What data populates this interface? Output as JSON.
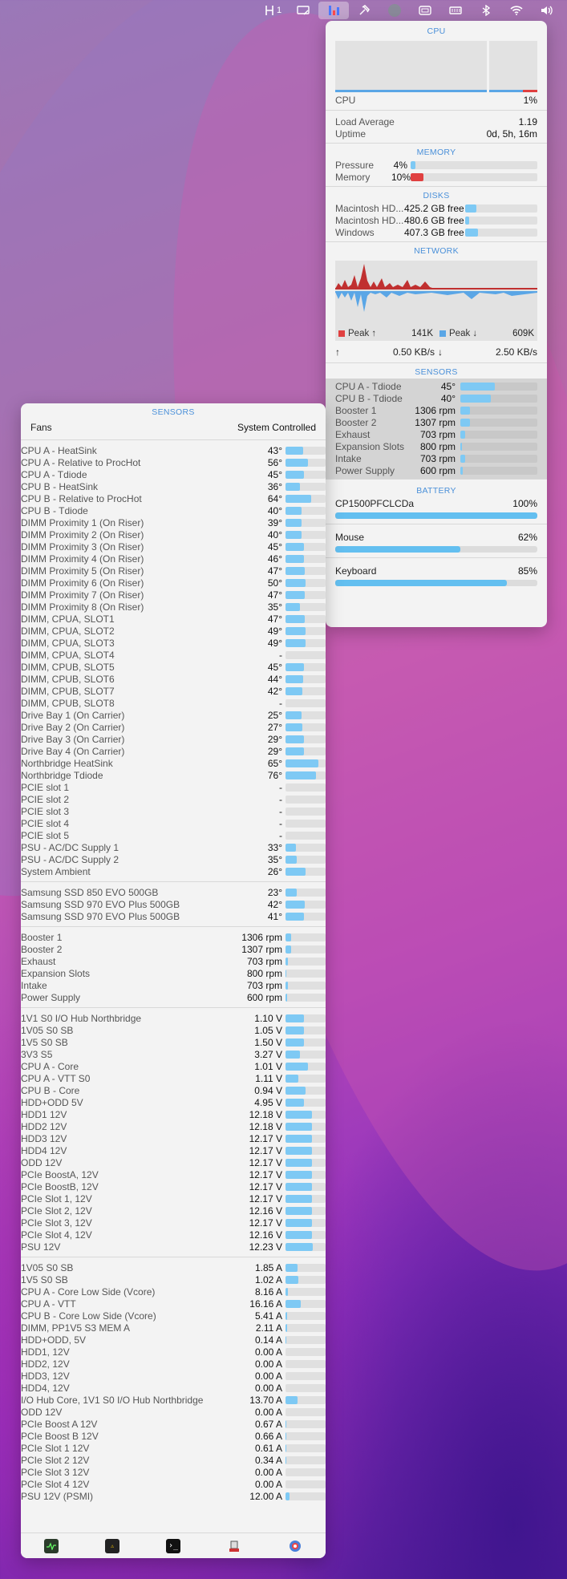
{
  "menubar": [
    {
      "icon": "hub-icon",
      "label": "1"
    },
    {
      "icon": "display-icon",
      "label": ""
    },
    {
      "icon": "stats-icon",
      "label": ""
    },
    {
      "icon": "hammer-icon",
      "label": ""
    },
    {
      "icon": "avatar-icon",
      "label": ""
    },
    {
      "icon": "window-icon",
      "label": ""
    },
    {
      "icon": "memory-icon",
      "label": ""
    },
    {
      "icon": "bluetooth-icon",
      "label": ""
    },
    {
      "icon": "wifi-icon",
      "label": ""
    },
    {
      "icon": "volume-icon",
      "label": ""
    }
  ],
  "right": {
    "cpu": {
      "title": "CPU",
      "label": "CPU",
      "value": "1%",
      "load_label": "Load Average",
      "load_value": "1.19",
      "uptime_label": "Uptime",
      "uptime_value": "0d, 5h, 16m"
    },
    "memory": {
      "title": "MEMORY",
      "rows": [
        {
          "label": "Pressure",
          "value": "4%",
          "level": 0.04,
          "color": "#7ec9f4"
        },
        {
          "label": "Memory",
          "value": "10%",
          "level": 0.1,
          "color": "#e04040"
        }
      ]
    },
    "disks": {
      "title": "DISKS",
      "rows": [
        {
          "label": "Macintosh HD...",
          "value": "425.2 GB free",
          "level": 0.15
        },
        {
          "label": "Macintosh HD...",
          "value": "480.6 GB free",
          "level": 0.06
        },
        {
          "label": "Windows",
          "value": "407.3 GB free",
          "level": 0.18
        }
      ]
    },
    "network": {
      "title": "NETWORK",
      "up_peak_label": "Peak ↑",
      "up_peak_value": "141K",
      "down_peak_label": "Peak ↓",
      "down_peak_value": "609K",
      "up_rate": "0.50 KB/s",
      "down_rate": "2.50 KB/s",
      "up_arrow": "↑",
      "down_arrow": "↓"
    },
    "sensors": {
      "title": "SENSORS",
      "rows": [
        {
          "label": "CPU A - Tdiode",
          "value": "45°",
          "level": 0.45
        },
        {
          "label": "CPU B - Tdiode",
          "value": "40°",
          "level": 0.4
        },
        {
          "label": "Booster 1",
          "value": "1306 rpm",
          "level": 0.13
        },
        {
          "label": "Booster 2",
          "value": "1307 rpm",
          "level": 0.13
        },
        {
          "label": "Exhaust",
          "value": "703 rpm",
          "level": 0.06
        },
        {
          "label": "Expansion Slots",
          "value": "800 rpm",
          "level": 0.02
        },
        {
          "label": "Intake",
          "value": "703 rpm",
          "level": 0.06
        },
        {
          "label": "Power Supply",
          "value": "600 rpm",
          "level": 0.03
        }
      ]
    },
    "battery": {
      "title": "BATTERY",
      "rows": [
        {
          "label": "CP1500PFCLCDa",
          "value": "100%",
          "level": 1.0
        },
        {
          "label": "Mouse",
          "value": "62%",
          "level": 0.62
        },
        {
          "label": "Keyboard",
          "value": "85%",
          "level": 0.85
        }
      ]
    }
  },
  "left": {
    "title": "SENSORS",
    "fans_label": "Fans",
    "fans_mode": "System Controlled",
    "groups": [
      [
        {
          "label": "CPU A - HeatSink",
          "value": "43°",
          "level": 0.43
        },
        {
          "label": "CPU A - Relative to ProcHot",
          "value": "56°",
          "level": 0.56
        },
        {
          "label": "CPU A - Tdiode",
          "value": "45°",
          "level": 0.45
        },
        {
          "label": "CPU B - HeatSink",
          "value": "36°",
          "level": 0.36
        },
        {
          "label": "CPU B - Relative to ProcHot",
          "value": "64°",
          "level": 0.64
        },
        {
          "label": "CPU B - Tdiode",
          "value": "40°",
          "level": 0.4
        },
        {
          "label": "DIMM Proximity 1 (On Riser)",
          "value": "39°",
          "level": 0.39
        },
        {
          "label": "DIMM Proximity 2 (On Riser)",
          "value": "40°",
          "level": 0.4
        },
        {
          "label": "DIMM Proximity 3 (On Riser)",
          "value": "45°",
          "level": 0.45
        },
        {
          "label": "DIMM Proximity 4 (On Riser)",
          "value": "46°",
          "level": 0.46
        },
        {
          "label": "DIMM Proximity 5 (On Riser)",
          "value": "47°",
          "level": 0.47
        },
        {
          "label": "DIMM Proximity 6 (On Riser)",
          "value": "50°",
          "level": 0.5
        },
        {
          "label": "DIMM Proximity 7 (On Riser)",
          "value": "47°",
          "level": 0.47
        },
        {
          "label": "DIMM Proximity 8 (On Riser)",
          "value": "35°",
          "level": 0.35
        },
        {
          "label": "DIMM, CPUA, SLOT1",
          "value": "47°",
          "level": 0.47
        },
        {
          "label": "DIMM, CPUA, SLOT2",
          "value": "49°",
          "level": 0.49
        },
        {
          "label": "DIMM, CPUA, SLOT3",
          "value": "49°",
          "level": 0.49
        },
        {
          "label": "DIMM, CPUA, SLOT4",
          "value": "-",
          "level": 0
        },
        {
          "label": "DIMM, CPUB, SLOT5",
          "value": "45°",
          "level": 0.45
        },
        {
          "label": "DIMM, CPUB, SLOT6",
          "value": "44°",
          "level": 0.44
        },
        {
          "label": "DIMM, CPUB, SLOT7",
          "value": "42°",
          "level": 0.42
        },
        {
          "label": "DIMM, CPUB, SLOT8",
          "value": "-",
          "level": 0
        },
        {
          "label": "Drive Bay 1 (On Carrier)",
          "value": "25°",
          "level": 0.4
        },
        {
          "label": "Drive Bay 2 (On Carrier)",
          "value": "27°",
          "level": 0.42
        },
        {
          "label": "Drive Bay 3 (On Carrier)",
          "value": "29°",
          "level": 0.45
        },
        {
          "label": "Drive Bay 4 (On Carrier)",
          "value": "29°",
          "level": 0.45
        },
        {
          "label": "Northbridge HeatSink",
          "value": "65°",
          "level": 0.82
        },
        {
          "label": "Northbridge Tdiode",
          "value": "76°",
          "level": 0.76
        },
        {
          "label": "PCIE slot 1",
          "value": "-",
          "level": 0
        },
        {
          "label": "PCIE slot 2",
          "value": "-",
          "level": 0
        },
        {
          "label": "PCIE slot 3",
          "value": "-",
          "level": 0
        },
        {
          "label": "PCIE slot 4",
          "value": "-",
          "level": 0
        },
        {
          "label": "PCIE slot 5",
          "value": "-",
          "level": 0
        },
        {
          "label": "PSU - AC/DC Supply 1",
          "value": "33°",
          "level": 0.25
        },
        {
          "label": "PSU - AC/DC Supply 2",
          "value": "35°",
          "level": 0.28
        },
        {
          "label": "System Ambient",
          "value": "26°",
          "level": 0.5
        }
      ],
      [
        {
          "label": "Samsung SSD 850 EVO 500GB",
          "value": "23°",
          "level": 0.28
        },
        {
          "label": "Samsung SSD 970 EVO Plus 500GB",
          "value": "42°",
          "level": 0.48
        },
        {
          "label": "Samsung SSD 970 EVO Plus 500GB",
          "value": "41°",
          "level": 0.46
        }
      ],
      [
        {
          "label": "Booster 1",
          "value": "1306 rpm",
          "level": 0.13
        },
        {
          "label": "Booster 2",
          "value": "1307 rpm",
          "level": 0.13
        },
        {
          "label": "Exhaust",
          "value": "703 rpm",
          "level": 0.06
        },
        {
          "label": "Expansion Slots",
          "value": "800 rpm",
          "level": 0.02
        },
        {
          "label": "Intake",
          "value": "703 rpm",
          "level": 0.06
        },
        {
          "label": "Power Supply",
          "value": "600 rpm",
          "level": 0.03
        }
      ],
      [
        {
          "label": "1V1 S0 I/O Hub Northbridge",
          "value": "1.10 V",
          "level": 0.45
        },
        {
          "label": "1V05 S0 SB",
          "value": "1.05 V",
          "level": 0.45
        },
        {
          "label": "1V5 S0 SB",
          "value": "1.50 V",
          "level": 0.45
        },
        {
          "label": "3V3 S5",
          "value": "3.27 V",
          "level": 0.36
        },
        {
          "label": "CPU A - Core",
          "value": "1.01 V",
          "level": 0.55
        },
        {
          "label": "CPU A - VTT S0",
          "value": "1.11 V",
          "level": 0.32
        },
        {
          "label": "CPU B - Core",
          "value": "0.94 V",
          "level": 0.5
        },
        {
          "label": "HDD+ODD 5V",
          "value": "4.95 V",
          "level": 0.45
        },
        {
          "label": "HDD1 12V",
          "value": "12.18 V",
          "level": 0.65
        },
        {
          "label": "HDD2 12V",
          "value": "12.18 V",
          "level": 0.65
        },
        {
          "label": "HDD3 12V",
          "value": "12.17 V",
          "level": 0.65
        },
        {
          "label": "HDD4 12V",
          "value": "12.17 V",
          "level": 0.65
        },
        {
          "label": "ODD 12V",
          "value": "12.17 V",
          "level": 0.65
        },
        {
          "label": "PCIe BoostA, 12V",
          "value": "12.17 V",
          "level": 0.65
        },
        {
          "label": "PCIe BoostB, 12V",
          "value": "12.17 V",
          "level": 0.65
        },
        {
          "label": "PCIe Slot 1, 12V",
          "value": "12.17 V",
          "level": 0.65
        },
        {
          "label": "PCIe Slot 2, 12V",
          "value": "12.16 V",
          "level": 0.65
        },
        {
          "label": "PCIe Slot 3, 12V",
          "value": "12.17 V",
          "level": 0.65
        },
        {
          "label": "PCIe Slot 4, 12V",
          "value": "12.16 V",
          "level": 0.65
        },
        {
          "label": "PSU 12V",
          "value": "12.23 V",
          "level": 0.68
        }
      ],
      [
        {
          "label": "1V05 S0 SB",
          "value": "1.85 A",
          "level": 0.3
        },
        {
          "label": "1V5 S0 SB",
          "value": "1.02 A",
          "level": 0.32
        },
        {
          "label": "CPU A - Core Low Side (Vcore)",
          "value": "8.16 A",
          "level": 0.05
        },
        {
          "label": "CPU A - VTT",
          "value": "16.16 A",
          "level": 0.38
        },
        {
          "label": "CPU B - Core Low Side (Vcore)",
          "value": "5.41 A",
          "level": 0.03
        },
        {
          "label": "DIMM, PP1V5 S3 MEM A",
          "value": "2.11 A",
          "level": 0.03
        },
        {
          "label": "HDD+ODD, 5V",
          "value": "0.14 A",
          "level": 0.02
        },
        {
          "label": "HDD1, 12V",
          "value": "0.00 A",
          "level": 0
        },
        {
          "label": "HDD2, 12V",
          "value": "0.00 A",
          "level": 0
        },
        {
          "label": "HDD3, 12V",
          "value": "0.00 A",
          "level": 0
        },
        {
          "label": "HDD4, 12V",
          "value": "0.00 A",
          "level": 0
        },
        {
          "label": "I/O Hub Core, 1V1 S0 I/O Hub Northbridge",
          "value": "13.70 A",
          "level": 0.3
        },
        {
          "label": "ODD 12V",
          "value": "0.00 A",
          "level": 0
        },
        {
          "label": "PCIe Boost A 12V",
          "value": "0.67 A",
          "level": 0.02
        },
        {
          "label": "PCIe Boost B 12V",
          "value": "0.66 A",
          "level": 0.02
        },
        {
          "label": "PCIe Slot 1 12V",
          "value": "0.61 A",
          "level": 0.02
        },
        {
          "label": "PCIe Slot 2 12V",
          "value": "0.34 A",
          "level": 0.02
        },
        {
          "label": "PCIe Slot 3 12V",
          "value": "0.00 A",
          "level": 0
        },
        {
          "label": "PCIe Slot 4 12V",
          "value": "0.00 A",
          "level": 0
        },
        {
          "label": "PSU 12V (PSMI)",
          "value": "12.00 A",
          "level": 0.1
        }
      ]
    ],
    "footer": [
      {
        "icon": "activity-monitor-icon"
      },
      {
        "icon": "console-icon"
      },
      {
        "icon": "terminal-icon"
      },
      {
        "icon": "sensors-app-icon"
      },
      {
        "icon": "settings-icon"
      }
    ]
  }
}
